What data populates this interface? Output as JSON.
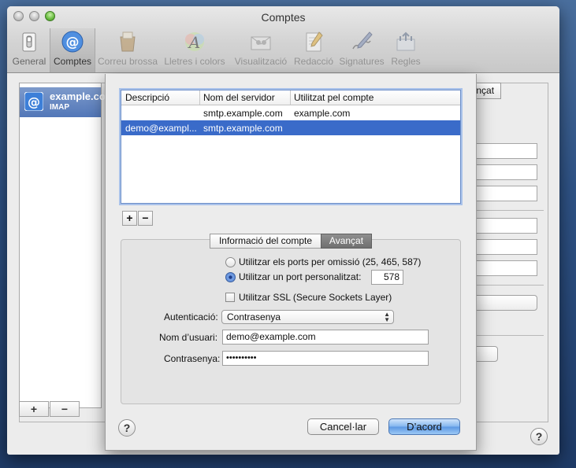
{
  "window": {
    "title": "Comptes"
  },
  "toolbar": {
    "items": [
      {
        "label": "General",
        "icon": "switch-icon"
      },
      {
        "label": "Comptes",
        "icon": "at-icon"
      },
      {
        "label": "Correu brossa",
        "icon": "junk-mail-icon"
      },
      {
        "label": "Lletres i colors",
        "icon": "fonts-colors-icon"
      },
      {
        "label": "Visualització",
        "icon": "viewing-icon"
      },
      {
        "label": "Redacció",
        "icon": "composing-icon"
      },
      {
        "label": "Signatures",
        "icon": "signatures-icon"
      },
      {
        "label": "Regles",
        "icon": "rules-icon"
      }
    ]
  },
  "accounts": {
    "selected_name": "example.com",
    "selected_type": "IMAP",
    "add_label": "+",
    "remove_label": "−"
  },
  "background": {
    "advanced_tab": "Avançat",
    "help": "?"
  },
  "sheet": {
    "table": {
      "headers": [
        "Descripció",
        "Nom del servidor",
        "Utilitzat pel compte"
      ],
      "rows": [
        {
          "desc": "",
          "server": "smtp.example.com",
          "used_by": "example.com",
          "selected": false
        },
        {
          "desc": "demo@exampl...",
          "server": "smtp.example.com",
          "used_by": "",
          "selected": true
        }
      ]
    },
    "add_label": "+",
    "remove_label": "−",
    "tabs": [
      "Informació del compte",
      "Avançat"
    ],
    "active_tab": 1,
    "ports": {
      "default_label": "Utilitzar els ports per omissió (25, 465, 587)",
      "custom_label": "Utilitzar un port personalitzat:",
      "custom_value": "578",
      "selected": "custom"
    },
    "ssl": {
      "label": "Utilitzar SSL (Secure Sockets Layer)",
      "checked": false
    },
    "auth": {
      "label": "Autenticació:",
      "value": "Contrasenya"
    },
    "username": {
      "label": "Nom d’usuari:",
      "value": "demo@example.com"
    },
    "password": {
      "label": "Contrasenya:",
      "value": "••••••••••"
    },
    "help": "?",
    "cancel_label": "Cancel·lar",
    "ok_label": "D’acord"
  },
  "colors": {
    "selection": "#3a6bc9",
    "default_button": "#5b97e3",
    "accent": "#3a6bc9"
  }
}
